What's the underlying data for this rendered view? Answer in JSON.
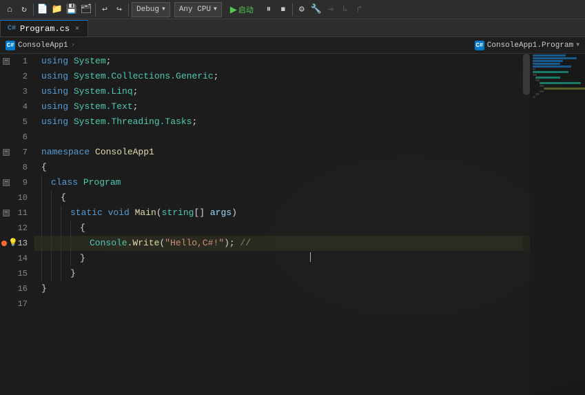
{
  "toolbar": {
    "debug_label": "Debug",
    "cpu_label": "Any CPU",
    "run_label": "启动",
    "undo_label": "Undo",
    "redo_label": "Redo"
  },
  "tab": {
    "name": "Program.cs",
    "icon": "C#",
    "close_label": "×"
  },
  "breadcrumb": {
    "left_icon": "C#",
    "left_text": "ConsoleApp1",
    "right_icon": "C#",
    "right_text": "ConsoleApp1.Program"
  },
  "code": {
    "lines": [
      {
        "num": 1,
        "has_collapse": true,
        "content": "using System;"
      },
      {
        "num": 2,
        "content": "using System.Collections.Generic;"
      },
      {
        "num": 3,
        "content": "using System.Linq;"
      },
      {
        "num": 4,
        "content": "using System.Text;"
      },
      {
        "num": 5,
        "content": "using System.Threading.Tasks;"
      },
      {
        "num": 6,
        "content": ""
      },
      {
        "num": 7,
        "has_collapse": true,
        "content": "namespace ConsoleApp1"
      },
      {
        "num": 8,
        "content": "{"
      },
      {
        "num": 9,
        "has_collapse": true,
        "content": "    class Program"
      },
      {
        "num": 10,
        "content": "    {"
      },
      {
        "num": 11,
        "has_collapse": true,
        "content": "        static void Main(string[] args)"
      },
      {
        "num": 12,
        "content": "        {"
      },
      {
        "num": 13,
        "has_dot": true,
        "has_bulb": true,
        "is_active": true,
        "content": "            Console.Write(\"Hello,C#!\"); //"
      },
      {
        "num": 14,
        "content": "        }"
      },
      {
        "num": 15,
        "content": "    }"
      },
      {
        "num": 16,
        "content": "}"
      },
      {
        "num": 17,
        "content": ""
      }
    ]
  }
}
